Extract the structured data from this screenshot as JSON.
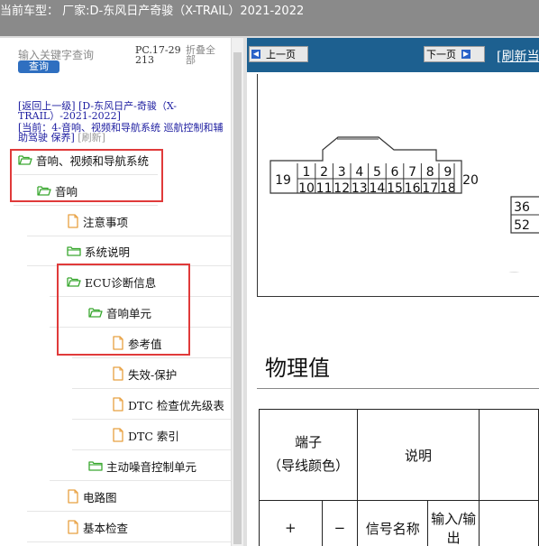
{
  "header": {
    "title": "当前车型： 厂家:D-东风日产奇骏（X-TRAIL）2021-2022"
  },
  "sidebar": {
    "search_placeholder": "输入关键字查询",
    "query_button": "查询",
    "pc_code": "PC.17-29213",
    "collapse_all": "折叠全部",
    "crumb_back": "[返回上一级]",
    "crumb_model": "[D-东风日产-奇骏（X-TRAIL）-2021-2022]",
    "crumb_current": "[当前：4-音响、视频和导航系统 巡航控制和辅助驾驶 保养]",
    "crumb_refresh": "[刷新]",
    "tree": [
      {
        "label": "音响、视频和导航系统",
        "icon": "folder-open-icon"
      },
      {
        "label": "音响",
        "icon": "folder-open-icon"
      },
      {
        "label": "注意事项",
        "icon": "document-icon"
      },
      {
        "label": "系统说明",
        "icon": "folder-icon"
      },
      {
        "label": "ECU诊断信息",
        "icon": "folder-open-icon"
      },
      {
        "label": "音响单元",
        "icon": "folder-open-icon"
      },
      {
        "label": "参考值",
        "icon": "document-icon"
      },
      {
        "label": "失效-保护",
        "icon": "document-icon"
      },
      {
        "label": "DTC 检查优先级表",
        "icon": "document-icon"
      },
      {
        "label": "DTC 索引",
        "icon": "document-icon"
      },
      {
        "label": "主动噪音控制单元",
        "icon": "folder-icon"
      },
      {
        "label": "电路图",
        "icon": "document-icon"
      },
      {
        "label": "基本检查",
        "icon": "document-icon"
      }
    ]
  },
  "viewer": {
    "prev_button": "上一页",
    "next_button": "下一页",
    "refresh_link": "[刷新当",
    "connector_top": [
      "1",
      "2",
      "3",
      "4",
      "5",
      "6",
      "7",
      "8",
      "9"
    ],
    "connector_bottom": [
      "10",
      "11",
      "12",
      "13",
      "14",
      "15",
      "16",
      "17",
      "18"
    ],
    "connector_left": "19",
    "connector_right": "20",
    "connector2_top": "36",
    "connector2_bottom": "52",
    "section_title": "物理值",
    "table": {
      "col_terminal": "端子",
      "col_terminal_sub": "（导线颜色）",
      "col_desc": "说明",
      "plus": "+",
      "minus": "−",
      "signal_name": "信号名称",
      "io": "输入/输出"
    }
  },
  "colors": {
    "nav_blue": "#1d6090",
    "highlight_red": "#e03a3a",
    "button_blue": "#2f6fc0",
    "folder_green": "#3aa830",
    "doc_orange": "#e8a040"
  }
}
